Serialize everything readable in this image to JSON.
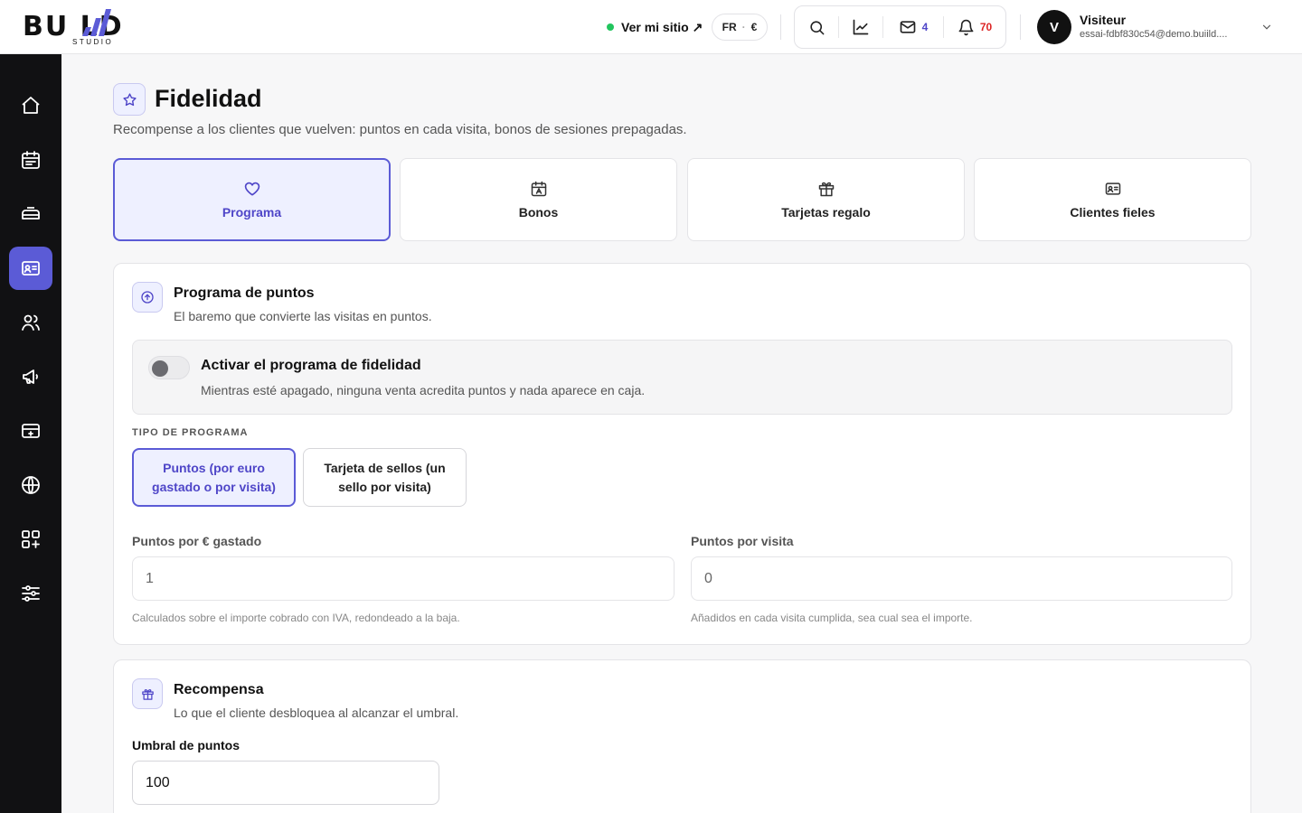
{
  "header": {
    "logo_text": "BU  LD",
    "logo_sub": "STUDIO",
    "site_link": "Ver mi sitio ↗",
    "lang": "FR",
    "currency": "€",
    "mail_count": "4",
    "notif_count": "70",
    "user_initial": "V",
    "user_name": "Visiteur",
    "user_email": "essai-fdbf830c54@demo.buiild...."
  },
  "page": {
    "title": "Fidelidad",
    "subtitle": "Recompense a los clientes que vuelven: puntos en cada visita, bonos de sesiones prepagadas."
  },
  "tabs": [
    {
      "label": "Programa",
      "icon": "heart-icon"
    },
    {
      "label": "Bonos",
      "icon": "calendar-icon"
    },
    {
      "label": "Tarjetas regalo",
      "icon": "gift-icon"
    },
    {
      "label": "Clientes fieles",
      "icon": "id-card-icon"
    }
  ],
  "points": {
    "title": "Programa de puntos",
    "subtitle": "El baremo que convierte las visitas en puntos.",
    "toggle_title": "Activar el programa de fidelidad",
    "toggle_sub": "Mientras esté apagado, ninguna venta acredita puntos y nada aparece en caja.",
    "toggle_on": false,
    "type_label": "TIPO DE PROGRAMA",
    "type_options": [
      "Puntos (por euro gastado o por visita)",
      "Tarjeta de sellos (un sello por visita)"
    ],
    "per_euro_label": "Puntos por € gastado",
    "per_euro_value": "1",
    "per_euro_help": "Calculados sobre el importe cobrado con IVA, redondeado a la baja.",
    "per_visit_label": "Puntos por visita",
    "per_visit_value": "0",
    "per_visit_help": "Añadidos en cada visita cumplida, sea cual sea el importe."
  },
  "reward": {
    "title": "Recompensa",
    "subtitle": "Lo que el cliente desbloquea al alcanzar el umbral.",
    "threshold_label": "Umbral de puntos",
    "threshold_value": "100"
  },
  "colors": {
    "accent": "#5b5bd6",
    "sidebar": "#111113",
    "status_dot": "#22c55e",
    "notif": "#dc2626"
  }
}
